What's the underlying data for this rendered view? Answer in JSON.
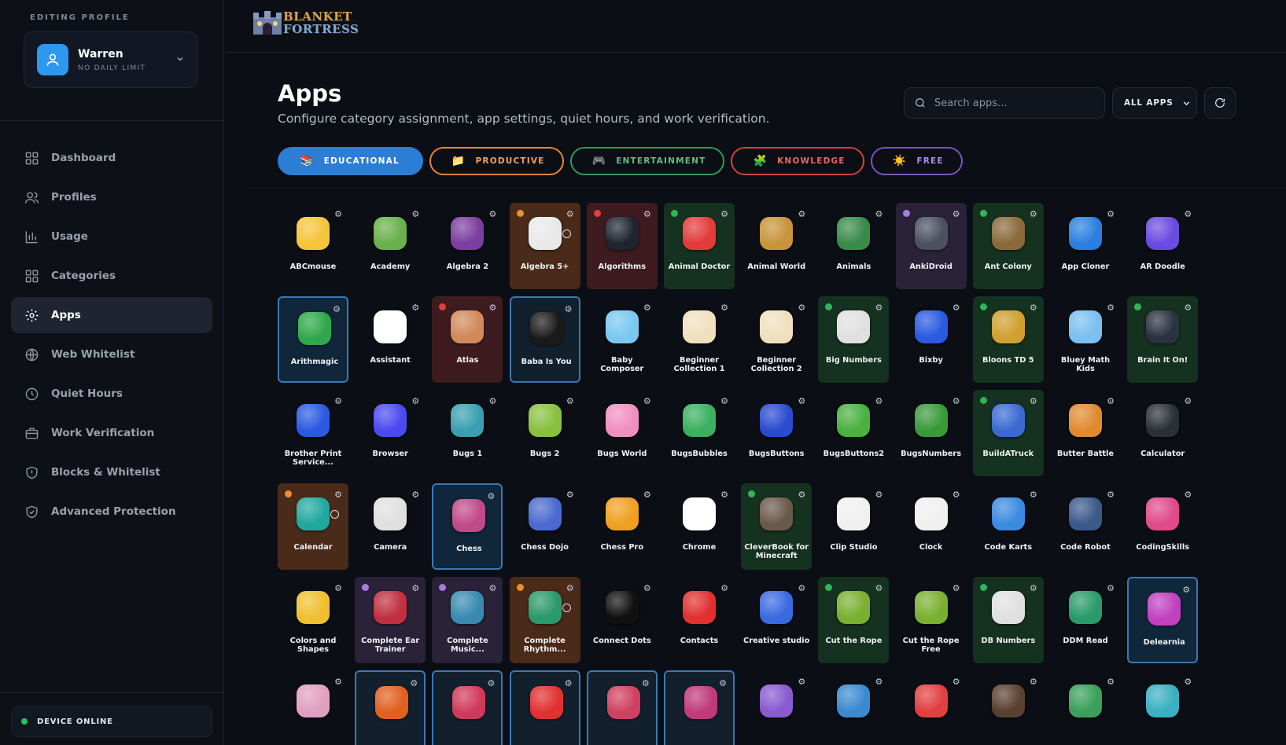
{
  "sidebar": {
    "editing_label": "EDITING PROFILE",
    "profile": {
      "name": "Warren",
      "subtitle": "NO DAILY LIMIT"
    },
    "nav": [
      {
        "label": "Dashboard",
        "icon": "grid-icon"
      },
      {
        "label": "Profiles",
        "icon": "users-icon"
      },
      {
        "label": "Usage",
        "icon": "bar-chart-icon"
      },
      {
        "label": "Categories",
        "icon": "grid-icon"
      },
      {
        "label": "Apps",
        "icon": "gear-icon",
        "active": true
      },
      {
        "label": "Web Whitelist",
        "icon": "globe-icon"
      },
      {
        "label": "Quiet Hours",
        "icon": "clock-icon"
      },
      {
        "label": "Work Verification",
        "icon": "briefcase-icon"
      },
      {
        "label": "Blocks & Whitelist",
        "icon": "shield-alert-icon"
      },
      {
        "label": "Advanced Protection",
        "icon": "shield-check-icon"
      }
    ],
    "status": "DEVICE ONLINE"
  },
  "header": {
    "logo_line1": "BLANKET",
    "logo_line2": "FORTRESS"
  },
  "main": {
    "title": "Apps",
    "subtitle": "Configure category assignment, app settings, quiet hours, and work verification.",
    "search_placeholder": "Search apps...",
    "filter_label": "ALL APPS",
    "categories": [
      {
        "label": "EDUCATIONAL",
        "color": "#2c7dd4"
      },
      {
        "label": "PRODUCTIVE",
        "color": "#e8853a"
      },
      {
        "label": "ENTERTAINMENT",
        "color": "#2f9a58"
      },
      {
        "label": "KNOWLEDGE",
        "color": "#d0423d"
      },
      {
        "label": "FREE",
        "color": "#7a52c4"
      }
    ],
    "apps": [
      {
        "name": "ABCmouse",
        "cat": "",
        "icon": "#f4c53a"
      },
      {
        "name": "Academy",
        "cat": "",
        "icon": "#6ab04c"
      },
      {
        "name": "Algebra 2",
        "cat": "",
        "icon": "#7b3fa0"
      },
      {
        "name": "Algebra 5+",
        "cat": "prod",
        "icon": "#e9e9e9",
        "clock": true
      },
      {
        "name": "Algorithms",
        "cat": "know",
        "icon": "#1f2430"
      },
      {
        "name": "Animal Doctor",
        "cat": "ent",
        "icon": "#e23b3b"
      },
      {
        "name": "Animal World",
        "cat": "",
        "icon": "#c8953a"
      },
      {
        "name": "Animals",
        "cat": "",
        "icon": "#3a8a4a"
      },
      {
        "name": "AnkiDroid",
        "cat": "free",
        "icon": "#4a5260"
      },
      {
        "name": "Ant Colony",
        "cat": "ent",
        "icon": "#8a6a3a"
      },
      {
        "name": "App Cloner",
        "cat": "",
        "icon": "#2a7fe0"
      },
      {
        "name": "AR Doodle",
        "cat": "",
        "icon": "#6a4ae0"
      },
      {
        "name": "Arithmagic",
        "cat": "sel",
        "icon": "#2ea84a"
      },
      {
        "name": "Assistant",
        "cat": "",
        "icon": "#ffffff"
      },
      {
        "name": "Atlas",
        "cat": "know",
        "icon": "#d08a5a"
      },
      {
        "name": "Baba Is You",
        "cat": "sel-dark",
        "icon": "#1a1a1a"
      },
      {
        "name": "Baby Composer",
        "cat": "",
        "icon": "#7ac8f0"
      },
      {
        "name": "Beginner Collection 1",
        "cat": "",
        "icon": "#f0e0c0"
      },
      {
        "name": "Beginner Collection 2",
        "cat": "",
        "icon": "#f0e0c0"
      },
      {
        "name": "Big Numbers",
        "cat": "ent",
        "icon": "#e0e0e0"
      },
      {
        "name": "Bixby",
        "cat": "",
        "icon": "#2a5ae0"
      },
      {
        "name": "Bloons TD 5",
        "cat": "ent",
        "icon": "#d0a030"
      },
      {
        "name": "Bluey Math Kids",
        "cat": "",
        "icon": "#7ac0f0"
      },
      {
        "name": "Brain It On!",
        "cat": "ent",
        "icon": "#2a3240"
      },
      {
        "name": "Brother Print Service...",
        "cat": "",
        "icon": "#2a5ae0"
      },
      {
        "name": "Browser",
        "cat": "",
        "icon": "#4a4af0"
      },
      {
        "name": "Bugs 1",
        "cat": "",
        "icon": "#3aa0b0"
      },
      {
        "name": "Bugs 2",
        "cat": "",
        "icon": "#8ac040"
      },
      {
        "name": "Bugs World",
        "cat": "",
        "icon": "#f090c0"
      },
      {
        "name": "BugsBubbles",
        "cat": "",
        "icon": "#3ab060"
      },
      {
        "name": "BugsButtons",
        "cat": "",
        "icon": "#2a4ad0"
      },
      {
        "name": "BugsButtons2",
        "cat": "",
        "icon": "#4ab040"
      },
      {
        "name": "BugsNumbers",
        "cat": "",
        "icon": "#3a9a3a"
      },
      {
        "name": "BuildATruck",
        "cat": "ent",
        "icon": "#3a6ad0"
      },
      {
        "name": "Butter Battle",
        "cat": "",
        "icon": "#e08a30"
      },
      {
        "name": "Calculator",
        "cat": "",
        "icon": "#2a3038"
      },
      {
        "name": "Calendar",
        "cat": "prod",
        "icon": "#20a8a0",
        "clock": true
      },
      {
        "name": "Camera",
        "cat": "",
        "icon": "#e0e0e0"
      },
      {
        "name": "Chess",
        "cat": "sel",
        "icon": "#c04a8a"
      },
      {
        "name": "Chess Dojo",
        "cat": "",
        "icon": "#4a6ad0"
      },
      {
        "name": "Chess Pro",
        "cat": "",
        "icon": "#f0a020"
      },
      {
        "name": "Chrome",
        "cat": "",
        "icon": "#ffffff"
      },
      {
        "name": "CleverBook for Minecraft",
        "cat": "ent",
        "icon": "#6a5a4a"
      },
      {
        "name": "Clip Studio",
        "cat": "",
        "icon": "#f0f0f0"
      },
      {
        "name": "Clock",
        "cat": "",
        "icon": "#f0f0f0"
      },
      {
        "name": "Code Karts",
        "cat": "",
        "icon": "#3a8ae0"
      },
      {
        "name": "Code Robot",
        "cat": "",
        "icon": "#3a5a8a"
      },
      {
        "name": "CodingSkills",
        "cat": "",
        "icon": "#e04a8a"
      },
      {
        "name": "Colors and Shapes",
        "cat": "",
        "icon": "#f0c030"
      },
      {
        "name": "Complete Ear Trainer",
        "cat": "free",
        "icon": "#c03040"
      },
      {
        "name": "Complete Music...",
        "cat": "free",
        "icon": "#3a8ab0"
      },
      {
        "name": "Complete Rhythm...",
        "cat": "prod",
        "icon": "#2a9a6a",
        "clock": true
      },
      {
        "name": "Connect Dots",
        "cat": "",
        "icon": "#101010"
      },
      {
        "name": "Contacts",
        "cat": "",
        "icon": "#e03030"
      },
      {
        "name": "Creative studio",
        "cat": "",
        "icon": "#3a6ae0"
      },
      {
        "name": "Cut the Rope",
        "cat": "ent",
        "icon": "#7ab030"
      },
      {
        "name": "Cut the Rope Free",
        "cat": "",
        "icon": "#7ab030"
      },
      {
        "name": "DB Numbers",
        "cat": "ent",
        "icon": "#e0e0e0"
      },
      {
        "name": "DDM Read",
        "cat": "",
        "icon": "#2a9a6a"
      },
      {
        "name": "Delearnia",
        "cat": "sel",
        "icon": "#c040c0"
      },
      {
        "name": "",
        "cat": "",
        "icon": "#e0a0c0"
      },
      {
        "name": "",
        "cat": "sel-dark",
        "icon": "#e06020"
      },
      {
        "name": "",
        "cat": "sel-dark",
        "icon": "#d03a5a"
      },
      {
        "name": "",
        "cat": "sel-dark",
        "icon": "#e03030"
      },
      {
        "name": "",
        "cat": "sel-dark",
        "icon": "#d04060"
      },
      {
        "name": "",
        "cat": "sel-dark",
        "icon": "#c03a7a"
      },
      {
        "name": "",
        "cat": "",
        "icon": "#8a5ad0"
      },
      {
        "name": "",
        "cat": "",
        "icon": "#3a8ad0"
      },
      {
        "name": "",
        "cat": "",
        "icon": "#e04040"
      },
      {
        "name": "",
        "cat": "",
        "icon": "#5a4030"
      },
      {
        "name": "",
        "cat": "",
        "icon": "#3aa05a"
      },
      {
        "name": "",
        "cat": "",
        "icon": "#3ab0c0"
      }
    ]
  },
  "colors": {
    "accent": "#2c7dd4",
    "online": "#22c55e",
    "dot_prod": "#f0902a",
    "dot_know": "#e04040",
    "dot_ent": "#2fb55a",
    "dot_free": "#a77be0"
  }
}
